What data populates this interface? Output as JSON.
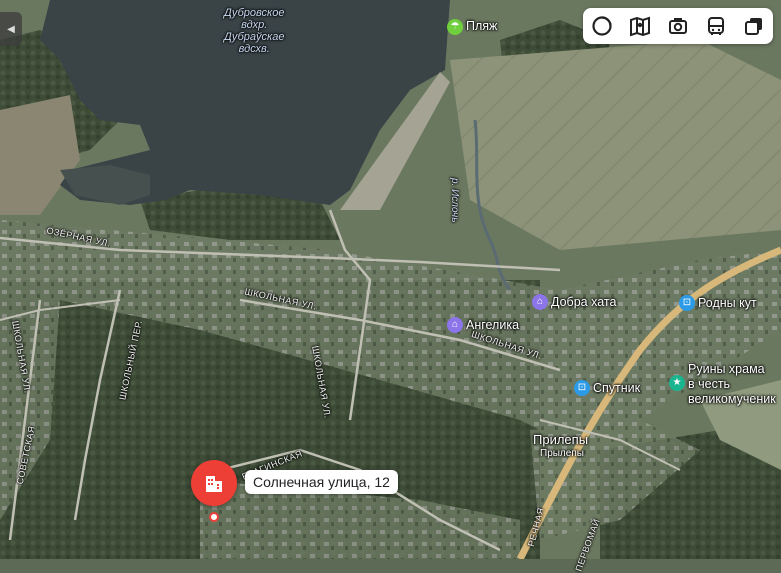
{
  "map": {
    "water_label": [
      "Дубровское",
      "вдхр.",
      "Дубраўскае",
      "вдсхв."
    ],
    "river_label": "р. Ислочь",
    "streets": {
      "ozernaya": "ОЗЁРНАЯ УЛ.",
      "shkolnaya_1": "ШКОЛЬНАЯ УЛ.",
      "shkolnaya_2": "ШКОЛЬНАЯ УЛ.",
      "shkolnaya_3": "ШКОЛЬНАЯ УЛ.",
      "shkolnaya_4": "ШКОЛЬНАЯ УЛ.",
      "shkolny_per": "ШКОЛЬНЫЙ ПЕР.",
      "sovetskaya": "СОВЕТСКАЯ",
      "bragin": "БРАГИНСКАЯ",
      "rechnaya": "РЕЧНАЯ",
      "pervomay": "ПЕРВОМАЙ"
    },
    "pois": {
      "beach": "Пляж",
      "dobra_hata": "Добра хата",
      "rodny_kut": "Родны кут",
      "angelika": "Ангелика",
      "sputnik": "Спутник",
      "ruins_line1": "Руины храма",
      "ruins_line2": "в честь",
      "ruins_line3": "великомученик"
    },
    "town": {
      "name": "Прилепы",
      "subname": "Прылепы"
    },
    "selected_address": "Солнечная улица, 12"
  },
  "toolbar": {
    "buttons": [
      "layers-icon",
      "traffic-map-icon",
      "panorama-camera-icon",
      "transport-bus-icon",
      "map-layers-switch-icon"
    ]
  }
}
